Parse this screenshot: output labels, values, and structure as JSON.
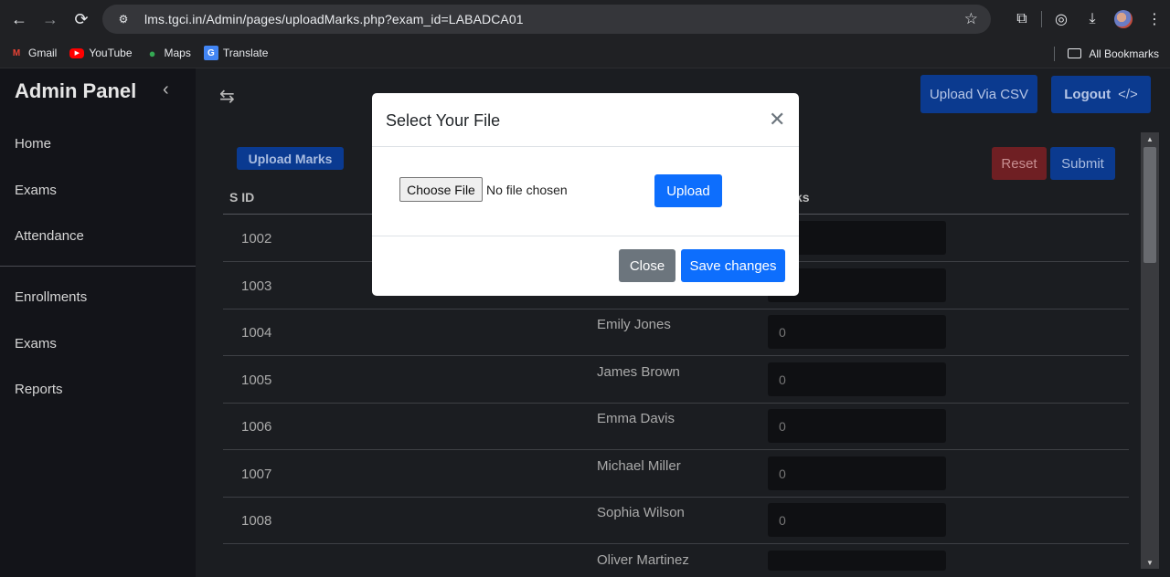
{
  "browser": {
    "url": "lms.tgci.in/Admin/pages/uploadMarks.php?exam_id=LABADCA01",
    "bookmarks": [
      {
        "label": "Gmail",
        "icon": "gmail-icon",
        "color": "#ea4335"
      },
      {
        "label": "YouTube",
        "icon": "youtube-icon",
        "color": "#ff0000"
      },
      {
        "label": "Maps",
        "icon": "maps-icon",
        "color": "#34a853"
      },
      {
        "label": "Translate",
        "icon": "translate-icon",
        "color": "#4285f4"
      }
    ],
    "all_bookmarks": "All Bookmarks"
  },
  "sidebar": {
    "brand": "Admin Panel",
    "items": [
      {
        "label": "Home"
      },
      {
        "label": "Exams"
      },
      {
        "label": "Attendance"
      },
      {
        "label": "Enrollments"
      },
      {
        "label": "Exams"
      },
      {
        "label": "Reports"
      }
    ]
  },
  "header": {
    "upload_csv": "Upload Via CSV",
    "logout": "Logout",
    "logout_icon": "</>"
  },
  "main": {
    "badge": "Upload Marks",
    "reset": "Reset",
    "submit": "Submit",
    "columns": [
      "S ID",
      "ks"
    ],
    "rows": [
      {
        "sid": "1002",
        "name": "",
        "marks": ""
      },
      {
        "sid": "1003",
        "name": "",
        "marks": ""
      },
      {
        "sid": "1004",
        "name": "Emily Jones",
        "marks": "0"
      },
      {
        "sid": "1005",
        "name": "James Brown",
        "marks": "0"
      },
      {
        "sid": "1006",
        "name": "Emma Davis",
        "marks": "0"
      },
      {
        "sid": "1007",
        "name": "Michael Miller",
        "marks": "0"
      },
      {
        "sid": "1008",
        "name": "Sophia Wilson",
        "marks": "0"
      },
      {
        "sid": "",
        "name": "Oliver Martinez",
        "marks": ""
      }
    ]
  },
  "modal": {
    "title": "Select Your File",
    "choose_file": "Choose File",
    "no_file": "No file chosen",
    "upload": "Upload",
    "close": "Close",
    "save": "Save changes"
  },
  "colors": {
    "primary": "#0d6efd",
    "secondary": "#6c757d",
    "sidebar_bg": "#131419"
  }
}
